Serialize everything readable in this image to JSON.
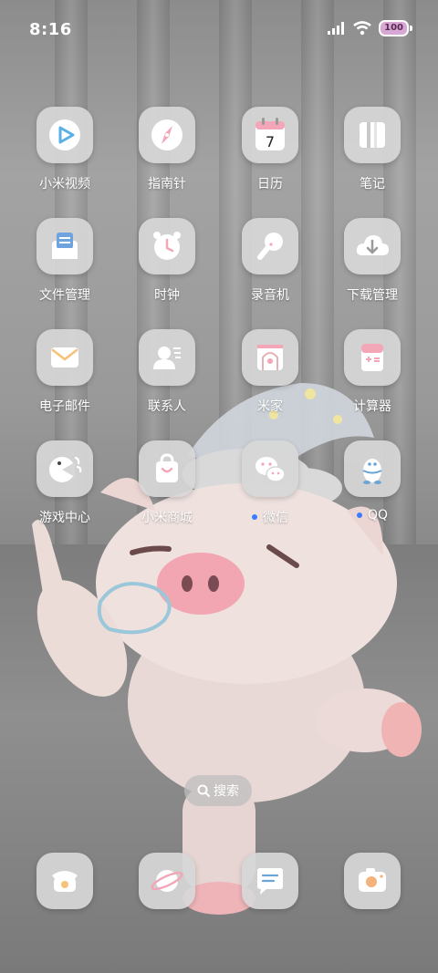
{
  "status_bar": {
    "time": "8:16",
    "battery": "100"
  },
  "apps": [
    {
      "label": "小米视频",
      "icon": "video-play-icon",
      "dot": false
    },
    {
      "label": "指南针",
      "icon": "compass-icon",
      "dot": false
    },
    {
      "label": "日历",
      "icon": "calendar-icon",
      "day": "7",
      "dot": false
    },
    {
      "label": "笔记",
      "icon": "notes-icon",
      "dot": false
    },
    {
      "label": "文件管理",
      "icon": "file-manager-icon",
      "dot": false
    },
    {
      "label": "时钟",
      "icon": "alarm-clock-icon",
      "dot": false
    },
    {
      "label": "录音机",
      "icon": "microphone-icon",
      "dot": false
    },
    {
      "label": "下载管理",
      "icon": "cloud-download-icon",
      "dot": false
    },
    {
      "label": "电子邮件",
      "icon": "mail-icon",
      "dot": false
    },
    {
      "label": "联系人",
      "icon": "contacts-icon",
      "dot": false
    },
    {
      "label": "米家",
      "icon": "mijia-home-icon",
      "dot": false
    },
    {
      "label": "计算器",
      "icon": "calculator-icon",
      "dot": false
    },
    {
      "label": "游戏中心",
      "icon": "game-center-icon",
      "dot": false
    },
    {
      "label": "小米商城",
      "icon": "shopping-bag-icon",
      "dot": false
    },
    {
      "label": "微信",
      "icon": "wechat-icon",
      "dot": true
    },
    {
      "label": "QQ",
      "icon": "qq-penguin-icon",
      "dot": true
    }
  ],
  "search": {
    "label": "搜索"
  },
  "dock": [
    {
      "icon": "phone-icon"
    },
    {
      "icon": "browser-planet-icon"
    },
    {
      "icon": "messages-icon"
    },
    {
      "icon": "camera-icon"
    }
  ],
  "colors": {
    "icon_bg": "#d7d7d7",
    "accent_pink": "#f2a6b8",
    "notification_dot": "#3d7bff"
  }
}
